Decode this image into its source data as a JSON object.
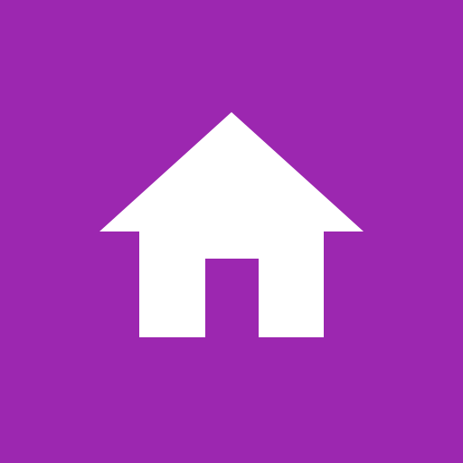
{
  "tile": {
    "icon": "home-icon",
    "background_color": "#9C27B0",
    "icon_color": "#FFFFFF"
  }
}
